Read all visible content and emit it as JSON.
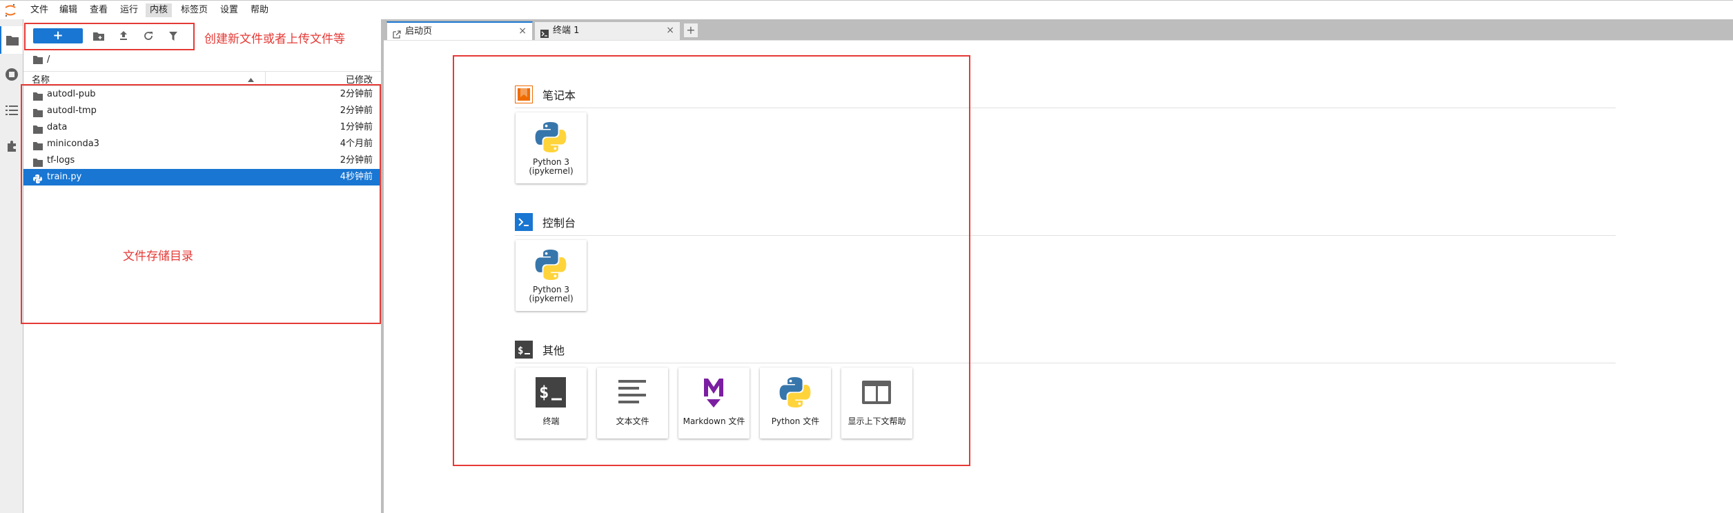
{
  "menubar": {
    "items": [
      "文件",
      "编辑",
      "查看",
      "运行",
      "内核",
      "标签页",
      "设置",
      "帮助"
    ],
    "active_index": 4
  },
  "sidebar": {
    "icons": [
      "folder-icon",
      "running-icon",
      "table-of-contents-icon",
      "extension-icon"
    ]
  },
  "file_browser": {
    "new_label": "+",
    "path": "/",
    "col_name": "名称",
    "col_modified": "已修改",
    "files": [
      {
        "name": "autodl-pub",
        "modified": "2分钟前",
        "type": "folder"
      },
      {
        "name": "autodl-tmp",
        "modified": "2分钟前",
        "type": "folder"
      },
      {
        "name": "data",
        "modified": "1分钟前",
        "type": "folder"
      },
      {
        "name": "miniconda3",
        "modified": "4个月前",
        "type": "folder"
      },
      {
        "name": "tf-logs",
        "modified": "2分钟前",
        "type": "folder"
      },
      {
        "name": "train.py",
        "modified": "4秒钟前",
        "type": "python",
        "selected": true
      }
    ]
  },
  "tabs": [
    {
      "label": "启动页",
      "close": "×",
      "active": true
    },
    {
      "label": "终端 1",
      "close": "×",
      "active": false
    }
  ],
  "tab_add": "+",
  "launcher": {
    "sections": [
      {
        "title": "笔记本",
        "cards": [
          {
            "label": "Python 3 (ipykernel)"
          }
        ]
      },
      {
        "title": "控制台",
        "cards": [
          {
            "label": "Python 3 (ipykernel)"
          }
        ]
      },
      {
        "title": "其他",
        "cards": [
          {
            "label": "终端"
          },
          {
            "label": "文本文件"
          },
          {
            "label": "Markdown 文件"
          },
          {
            "label": "Python 文件"
          },
          {
            "label": "显示上下文帮助"
          }
        ]
      }
    ]
  },
  "annotations": {
    "toolbar_note": "创建新文件或者上传文件等",
    "files_note": "文件存储目录"
  },
  "colors": {
    "accent": "#1976d2",
    "annotation_red": "#e53935",
    "notebook_orange": "#ef6c00"
  }
}
